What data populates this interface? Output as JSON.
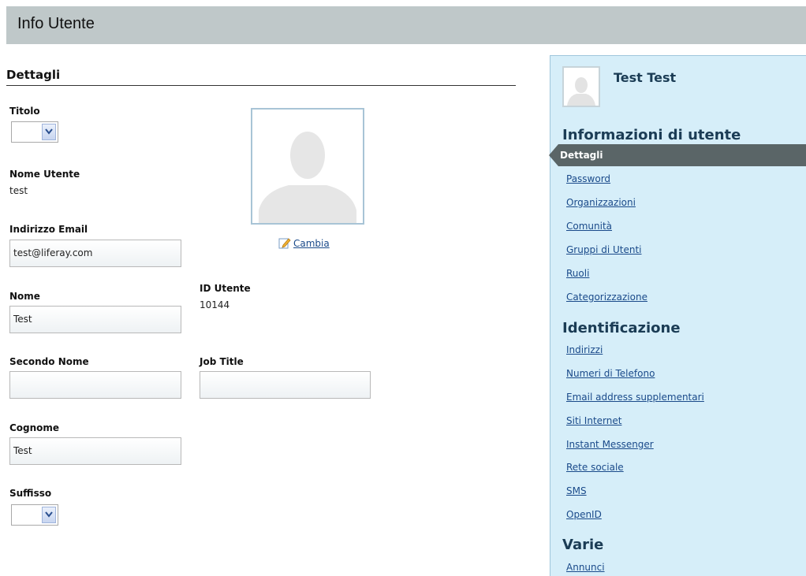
{
  "header": {
    "title": "Info Utente"
  },
  "details": {
    "section_title": "Dettagli",
    "fields": {
      "titolo_label": "Titolo",
      "nome_utente_label": "Nome Utente",
      "nome_utente_value": "test",
      "email_label": "Indirizzo Email",
      "email_value": "test@liferay.com",
      "nome_label": "Nome",
      "nome_value": "Test",
      "id_utente_label": "ID Utente",
      "id_utente_value": "10144",
      "secondo_nome_label": "Secondo Nome",
      "secondo_nome_value": "",
      "job_title_label": "Job Title",
      "job_title_value": "",
      "cognome_label": "Cognome",
      "cognome_value": "Test",
      "suffisso_label": "Suffisso"
    },
    "change_link": "Cambia"
  },
  "sidebar": {
    "user_name": "Test Test",
    "sections": [
      {
        "title": "Informazioni di utente",
        "items": [
          "Dettagli",
          "Password",
          "Organizzazioni",
          "Comunità",
          "Gruppi di Utenti",
          "Ruoli",
          "Categorizzazione"
        ]
      },
      {
        "title": "Identificazione",
        "items": [
          "Indirizzi",
          "Numeri di Telefono",
          "Email address supplementari",
          "Siti Internet",
          "Instant Messenger",
          "Rete sociale",
          "SMS",
          "OpenID"
        ]
      },
      {
        "title": "Varie",
        "items": [
          "Annunci"
        ]
      }
    ],
    "active_item": "Dettagli"
  },
  "colors": {
    "header_bg": "#bfc8c9",
    "sidebar_bg": "#d6eef9",
    "active_bg": "#5a6567",
    "link": "#1a4a8a"
  },
  "icons": [
    "user-placeholder-icon",
    "pencil-icon",
    "chevron-down-icon"
  ]
}
